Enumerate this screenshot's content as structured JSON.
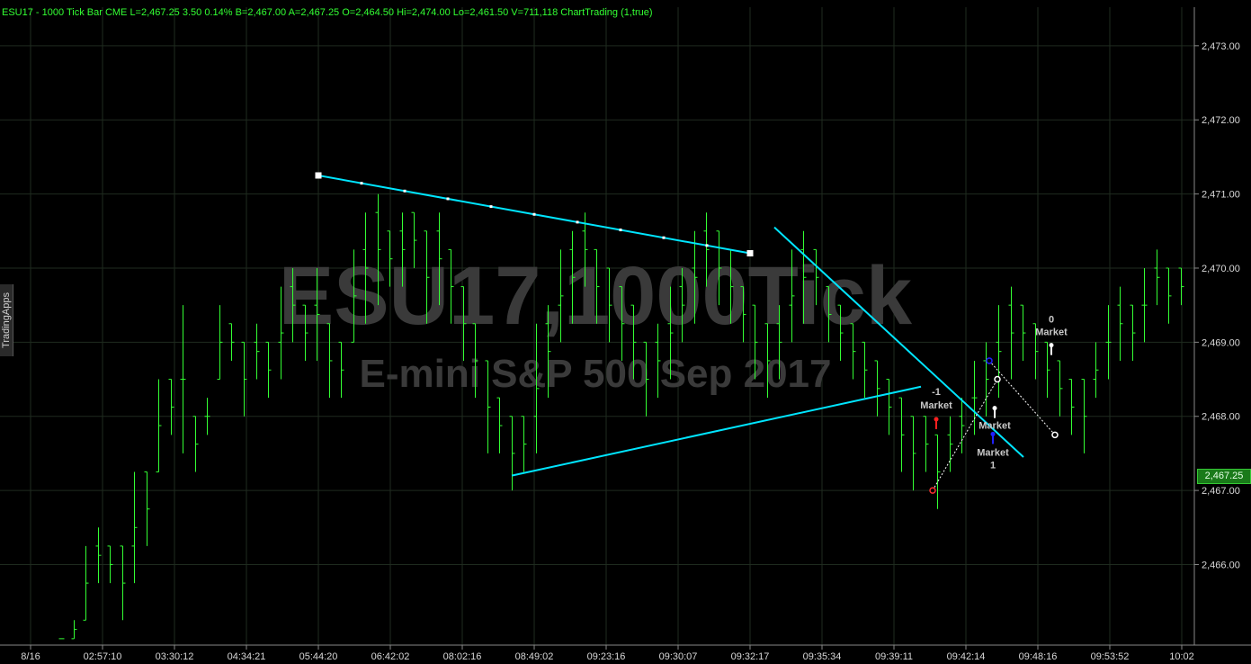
{
  "header": {
    "symbol_text": "ESU17 - 1000 Tick Bar  CME  L=2,467.25  3.50   0.14%  B=2,467.00  A=2,467.25  O=2,464.50  Hi=2,474.00  Lo=2,461.50  V=711,118  ChartTrading (1,true)"
  },
  "sidebar_tab": {
    "label": "TradingApps"
  },
  "watermark": {
    "line1": "ESU17,1000Tick",
    "line2": "E-mini S&P 500 Sep 2017"
  },
  "last_price_label": "2,467.25",
  "colors": {
    "background": "#000000",
    "bars": "#33ff33",
    "trendline": "#00e5ff",
    "grid": "#1e2a1e",
    "buy": "#1010ff",
    "sell": "#ff2020"
  },
  "chart_data": {
    "type": "bar",
    "title": "",
    "xlabel": "",
    "ylabel": "",
    "ylim": [
      2465.0,
      2473.5
    ],
    "y_ticks": [
      "2,473.00",
      "2,472.00",
      "2,471.00",
      "2,470.00",
      "2,469.00",
      "2,468.00",
      "2,467.00",
      "2,466.00"
    ],
    "y_tick_values": [
      2473,
      2472,
      2471,
      2470,
      2469,
      2468,
      2467,
      2466
    ],
    "x_ticks": [
      "8/16",
      "02:57:10",
      "03:30:12",
      "04:34:21",
      "05:44:20",
      "06:42:02",
      "08:02:16",
      "08:49:02",
      "09:23:16",
      "09:30:07",
      "09:32:17",
      "09:35:34",
      "09:39:11",
      "09:42:14",
      "09:48:16",
      "09:53:52",
      "10:02"
    ],
    "grid": true,
    "last_price": 2467.25,
    "bars": [
      [
        2465.0,
        2465.0
      ],
      [
        2465.0,
        2465.25
      ],
      [
        2465.25,
        2466.25
      ],
      [
        2465.75,
        2466.5
      ],
      [
        2465.75,
        2466.25
      ],
      [
        2465.25,
        2466.25
      ],
      [
        2465.75,
        2467.25
      ],
      [
        2466.25,
        2467.25
      ],
      [
        2467.25,
        2468.5
      ],
      [
        2467.75,
        2468.5
      ],
      [
        2467.5,
        2469.5
      ],
      [
        2467.25,
        2468.0
      ],
      [
        2467.75,
        2468.25
      ],
      [
        2468.5,
        2469.5
      ],
      [
        2468.75,
        2469.25
      ],
      [
        2468.0,
        2469.0
      ],
      [
        2468.5,
        2469.25
      ],
      [
        2468.25,
        2469.0
      ],
      [
        2468.5,
        2469.75
      ],
      [
        2469.0,
        2470.0
      ],
      [
        2468.75,
        2469.5
      ],
      [
        2468.75,
        2470.0
      ],
      [
        2468.25,
        2469.25
      ],
      [
        2468.25,
        2469.0
      ],
      [
        2469.0,
        2470.25
      ],
      [
        2469.25,
        2470.75
      ],
      [
        2469.5,
        2471.0
      ],
      [
        2469.75,
        2470.5
      ],
      [
        2469.75,
        2470.75
      ],
      [
        2470.0,
        2470.75
      ],
      [
        2469.25,
        2470.5
      ],
      [
        2469.5,
        2470.75
      ],
      [
        2469.25,
        2470.25
      ],
      [
        2468.75,
        2469.75
      ],
      [
        2468.25,
        2469.25
      ],
      [
        2467.5,
        2468.75
      ],
      [
        2467.5,
        2468.25
      ],
      [
        2467.0,
        2468.0
      ],
      [
        2467.25,
        2468.0
      ],
      [
        2467.5,
        2469.25
      ],
      [
        2468.25,
        2469.5
      ],
      [
        2469.0,
        2470.25
      ],
      [
        2469.25,
        2470.5
      ],
      [
        2469.75,
        2470.75
      ],
      [
        2469.25,
        2470.25
      ],
      [
        2469.0,
        2470.0
      ],
      [
        2468.75,
        2469.75
      ],
      [
        2468.5,
        2469.5
      ],
      [
        2468.0,
        2469.0
      ],
      [
        2468.25,
        2469.25
      ],
      [
        2468.5,
        2469.75
      ],
      [
        2469.0,
        2470.0
      ],
      [
        2469.25,
        2470.5
      ],
      [
        2469.75,
        2470.75
      ],
      [
        2469.5,
        2470.5
      ],
      [
        2469.25,
        2470.25
      ],
      [
        2469.0,
        2469.75
      ],
      [
        2468.5,
        2469.5
      ],
      [
        2468.25,
        2469.25
      ],
      [
        2468.5,
        2469.5
      ],
      [
        2469.0,
        2470.25
      ],
      [
        2469.25,
        2470.5
      ],
      [
        2469.5,
        2470.25
      ],
      [
        2469.0,
        2469.75
      ],
      [
        2468.75,
        2469.5
      ],
      [
        2468.5,
        2469.25
      ],
      [
        2468.25,
        2469.0
      ],
      [
        2468.0,
        2468.75
      ],
      [
        2467.75,
        2468.5
      ],
      [
        2467.25,
        2468.25
      ],
      [
        2467.0,
        2468.0
      ],
      [
        2467.25,
        2468.0
      ],
      [
        2466.75,
        2467.75
      ],
      [
        2467.25,
        2468.0
      ],
      [
        2467.5,
        2468.25
      ],
      [
        2467.75,
        2468.75
      ],
      [
        2468.0,
        2469.0
      ],
      [
        2468.25,
        2469.5
      ],
      [
        2468.5,
        2469.75
      ],
      [
        2468.75,
        2469.5
      ],
      [
        2468.5,
        2469.25
      ],
      [
        2468.25,
        2469.0
      ],
      [
        2468.0,
        2468.75
      ],
      [
        2467.75,
        2468.5
      ],
      [
        2467.5,
        2468.5
      ],
      [
        2468.25,
        2469.0
      ],
      [
        2468.5,
        2469.5
      ],
      [
        2468.75,
        2469.75
      ],
      [
        2468.75,
        2469.5
      ],
      [
        2469.0,
        2470.0
      ],
      [
        2469.5,
        2470.25
      ],
      [
        2469.25,
        2470.0
      ],
      [
        2469.5,
        2470.0
      ]
    ],
    "trendlines": [
      {
        "name": "upper-falling",
        "from": [
          "05:44:20",
          2471.25
        ],
        "to": [
          "09:32:17",
          2470.2
        ]
      },
      {
        "name": "rising-support",
        "from": [
          "08:02:16",
          2467.2
        ],
        "to": [
          "09:39:11",
          2468.4
        ]
      },
      {
        "name": "steep-falling",
        "from": [
          "09:32:17",
          2470.55
        ],
        "to": [
          "09:48:16",
          2467.45
        ]
      }
    ],
    "trade_markers": [
      {
        "qty_label": "-1",
        "type_label": "Market",
        "side": "sell",
        "price": 2467.9
      },
      {
        "qty_label": "",
        "type_label": "Market",
        "side": "exit",
        "price": 2468.05
      },
      {
        "qty_label": "1",
        "type_label": "Market",
        "side": "buy",
        "price": 2467.7
      },
      {
        "qty_label": "0",
        "type_label": "Market",
        "side": "exit",
        "price": 2468.9
      }
    ]
  }
}
